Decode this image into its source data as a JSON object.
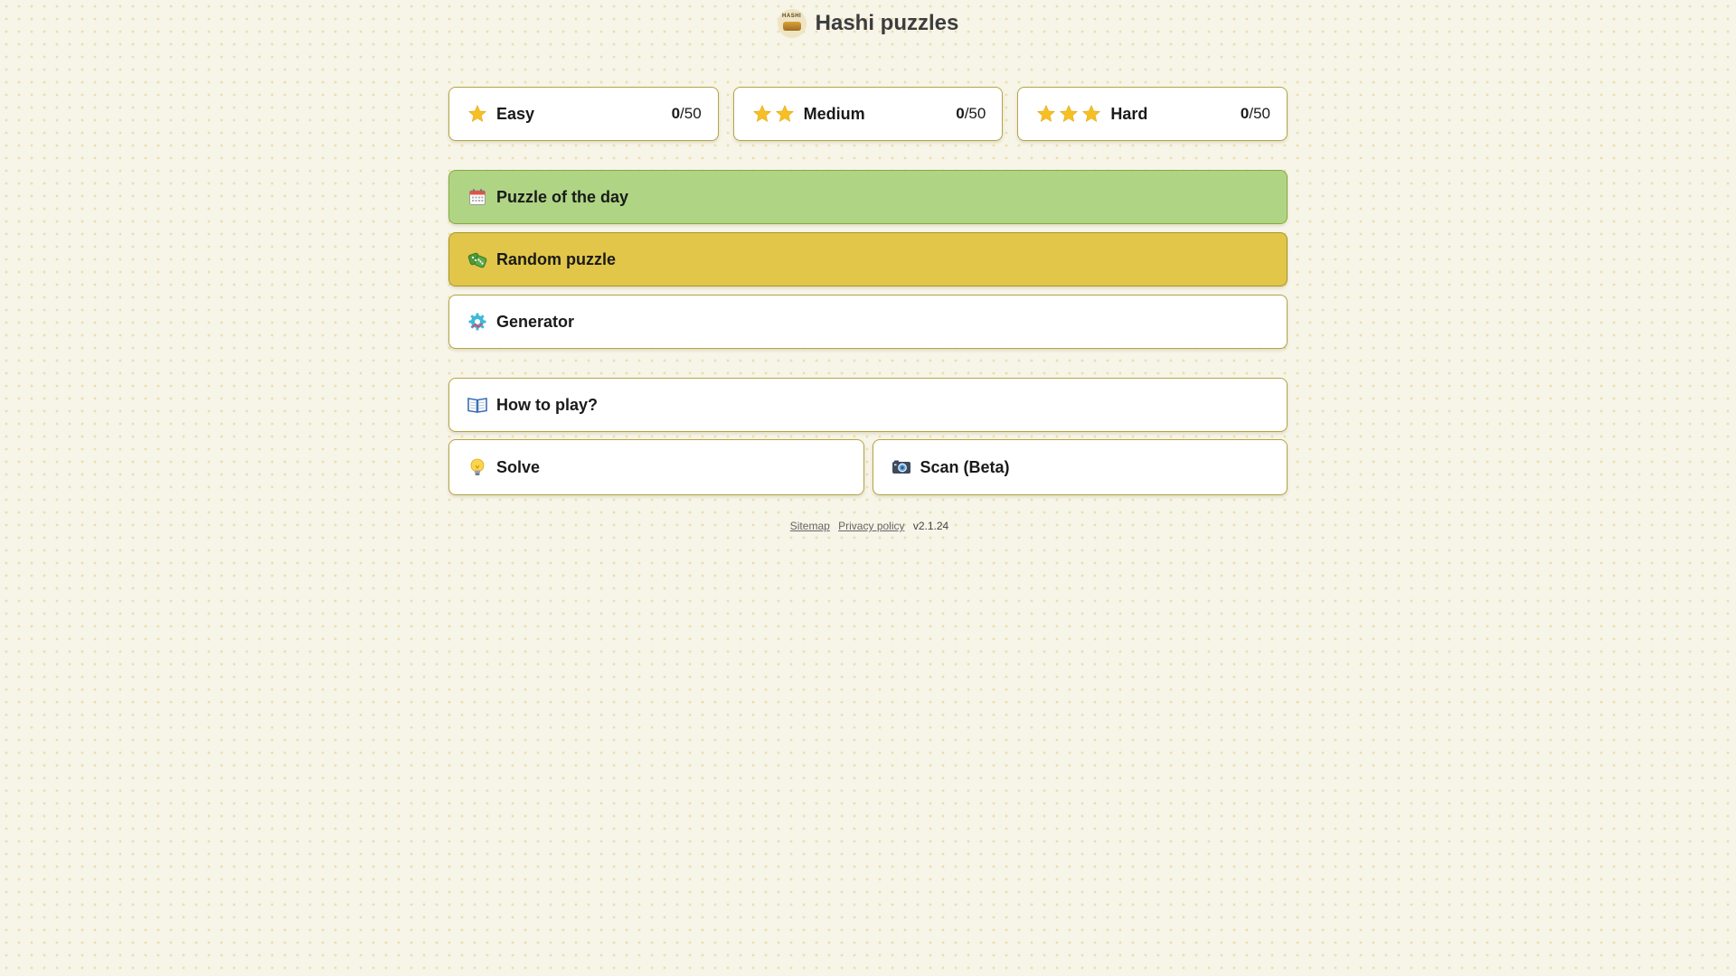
{
  "app": {
    "title": "Hashi puzzles",
    "logo_text": "HASHI"
  },
  "levels": [
    {
      "label": "Easy",
      "stars": 1,
      "solved": "0",
      "total": "/50"
    },
    {
      "label": "Medium",
      "stars": 2,
      "solved": "0",
      "total": "/50"
    },
    {
      "label": "Hard",
      "stars": 3,
      "solved": "0",
      "total": "/50"
    }
  ],
  "menu": {
    "puzzle_of_day": {
      "label": "Puzzle of the day",
      "icon": "calendar-icon",
      "color": "#afd584"
    },
    "random_puzzle": {
      "label": "Random puzzle",
      "icon": "dice-icon",
      "color": "#e1c64a"
    },
    "generator": {
      "label": "Generator",
      "icon": "gear-icon"
    },
    "how_to_play": {
      "label": "How to play?",
      "icon": "book-icon"
    },
    "solve": {
      "label": "Solve",
      "icon": "lightbulb-icon"
    },
    "scan": {
      "label": "Scan (Beta)",
      "icon": "camera-icon"
    }
  },
  "footer": {
    "sitemap": "Sitemap",
    "privacy": "Privacy policy",
    "version": "v2.1.24"
  },
  "colors": {
    "star": "#f6c024",
    "border": "#b4a545",
    "background": "#f7f4e8"
  }
}
